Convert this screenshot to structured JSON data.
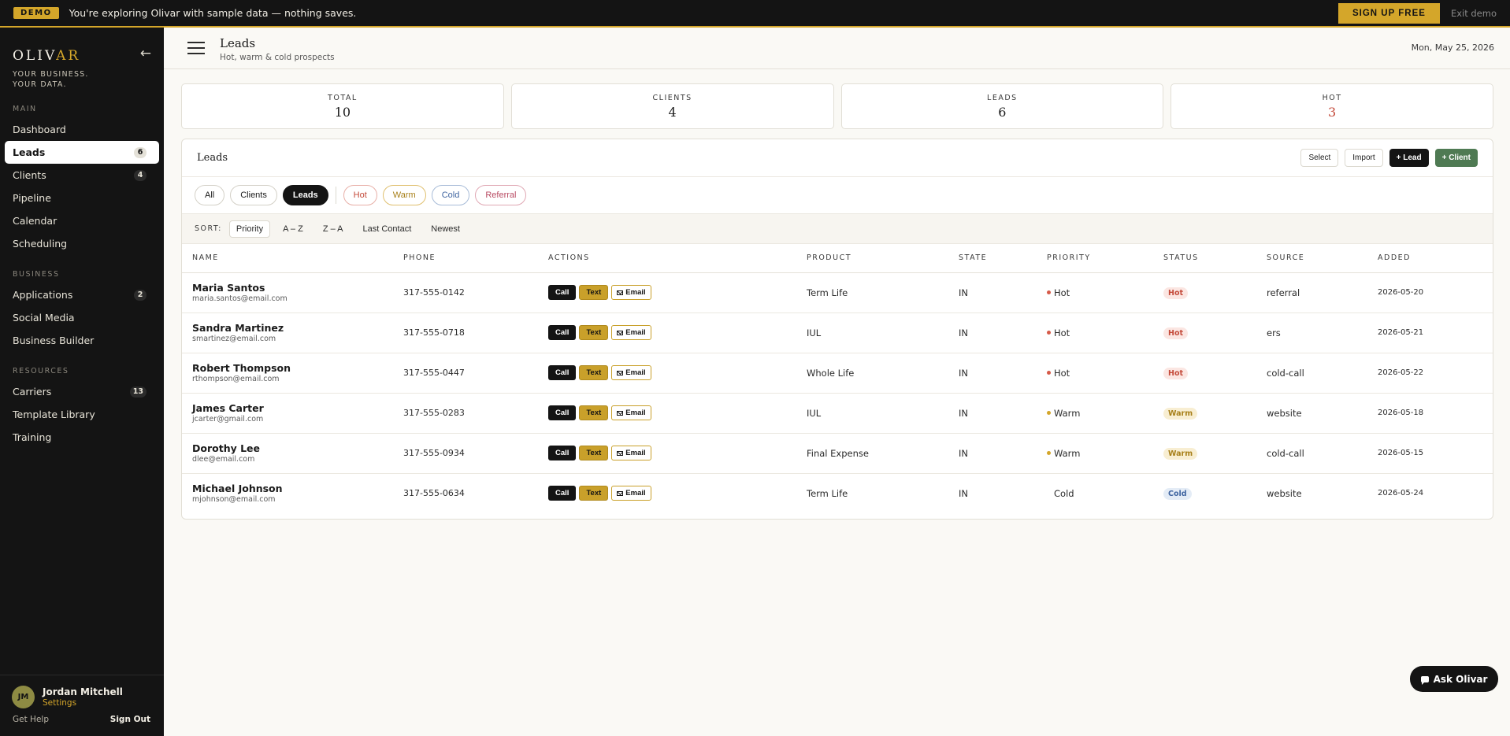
{
  "banner": {
    "tag": "DEMO",
    "message": "You're exploring Olivar with sample data — nothing saves.",
    "signup": "SIGN UP FREE",
    "exit": "Exit demo"
  },
  "sidebar": {
    "logo_main": "OLIV",
    "logo_accent": "AR",
    "tagline": "YOUR BUSINESS. YOUR DATA.",
    "sections": [
      {
        "title": "MAIN",
        "items": [
          {
            "label": "Dashboard",
            "badge": ""
          },
          {
            "label": "Leads",
            "badge": "6"
          },
          {
            "label": "Clients",
            "badge": "4"
          },
          {
            "label": "Pipeline",
            "badge": ""
          },
          {
            "label": "Calendar",
            "badge": ""
          },
          {
            "label": "Scheduling",
            "badge": ""
          }
        ]
      },
      {
        "title": "BUSINESS",
        "items": [
          {
            "label": "Applications",
            "badge": "2"
          },
          {
            "label": "Social Media",
            "badge": ""
          },
          {
            "label": "Business Builder",
            "badge": ""
          }
        ]
      },
      {
        "title": "RESOURCES",
        "items": [
          {
            "label": "Carriers",
            "badge": "13"
          },
          {
            "label": "Template Library",
            "badge": ""
          },
          {
            "label": "Training",
            "badge": ""
          }
        ]
      }
    ],
    "user": {
      "initials": "JM",
      "name": "Jordan Mitchell",
      "settings": "Settings"
    },
    "get_help": "Get Help",
    "sign_out": "Sign Out"
  },
  "header": {
    "title": "Leads",
    "subtitle": "Hot, warm & cold prospects",
    "date": "Mon, May 25, 2026"
  },
  "stats": [
    {
      "label": "TOTAL",
      "value": "10"
    },
    {
      "label": "CLIENTS",
      "value": "4"
    },
    {
      "label": "LEADS",
      "value": "6"
    },
    {
      "label": "HOT",
      "value": "3"
    }
  ],
  "panel": {
    "title": "Leads",
    "select": "Select",
    "import": "Import",
    "add_lead": "+ Lead",
    "add_client": "+ Client"
  },
  "filters": {
    "view": [
      "All",
      "Clients",
      "Leads"
    ],
    "tags": [
      "Hot",
      "Warm",
      "Cold",
      "Referral"
    ]
  },
  "sort": {
    "label": "SORT:",
    "options": [
      "Priority",
      "A – Z",
      "Z – A",
      "Last Contact",
      "Newest"
    ]
  },
  "table": {
    "headers": [
      "NAME",
      "PHONE",
      "ACTIONS",
      "PRODUCT",
      "STATE",
      "PRIORITY",
      "STATUS",
      "SOURCE",
      "ADDED"
    ],
    "actions": {
      "call": "Call",
      "text": "Text",
      "email": "Email"
    },
    "rows": [
      {
        "name": "Maria Santos",
        "email": "maria.santos@email.com",
        "phone": "317-555-0142",
        "product": "Term Life",
        "state": "IN",
        "priority": "Hot",
        "status": "Hot",
        "source": "referral",
        "added": "2026-05-20"
      },
      {
        "name": "Sandra Martinez",
        "email": "smartinez@email.com",
        "phone": "317-555-0718",
        "product": "IUL",
        "state": "IN",
        "priority": "Hot",
        "status": "Hot",
        "source": "ers",
        "added": "2026-05-21"
      },
      {
        "name": "Robert Thompson",
        "email": "rthompson@email.com",
        "phone": "317-555-0447",
        "product": "Whole Life",
        "state": "IN",
        "priority": "Hot",
        "status": "Hot",
        "source": "cold-call",
        "added": "2026-05-22"
      },
      {
        "name": "James Carter",
        "email": "jcarter@gmail.com",
        "phone": "317-555-0283",
        "product": "IUL",
        "state": "IN",
        "priority": "Warm",
        "status": "Warm",
        "source": "website",
        "added": "2026-05-18"
      },
      {
        "name": "Dorothy Lee",
        "email": "dlee@email.com",
        "phone": "317-555-0934",
        "product": "Final Expense",
        "state": "IN",
        "priority": "Warm",
        "status": "Warm",
        "source": "cold-call",
        "added": "2026-05-15"
      },
      {
        "name": "Michael Johnson",
        "email": "mjohnson@email.com",
        "phone": "317-555-0634",
        "product": "Term Life",
        "state": "IN",
        "priority": "Cold",
        "status": "Cold",
        "source": "website",
        "added": "2026-05-24"
      }
    ]
  },
  "ask": {
    "label": "Ask Olivar"
  },
  "colors": {
    "accent": "#d4a62a",
    "sidebar": "#141414",
    "green": "#4f7a53",
    "hot": "#c44a3a"
  }
}
